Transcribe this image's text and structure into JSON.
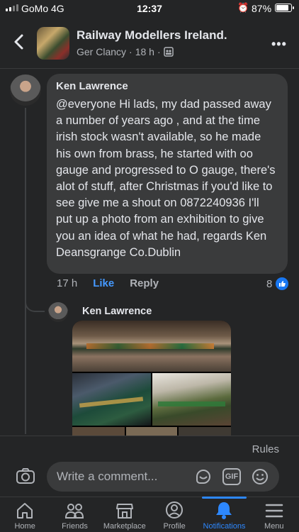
{
  "status_bar": {
    "carrier": "GoMo  4G",
    "time": "12:37",
    "battery_percent": "87%",
    "battery_level": 0.87,
    "alarm_icon": "alarm-clock-icon"
  },
  "header": {
    "group_name": "Railway Modellers Ireland.",
    "poster_name": "Ger Clancy",
    "post_age": "18 h",
    "separator": "·",
    "privacy_icon": "group-members-icon",
    "more_label": "•••"
  },
  "comment": {
    "author": "Ken Lawrence",
    "text": "@everyone Hi lads, my dad passed away a number of years ago , and at the time irish stock wasn't available,  so he made his own from brass, he started with oo gauge and progressed to O gauge, there's alot of stuff, after Christmas if you'd like to see give me a shout on 0872240936 I'll put up a photo from an exhibition to give you an idea of what he had, regards Ken\nDeansgrange Co.Dublin",
    "time": "17 h",
    "like_label": "Like",
    "reply_label": "Reply",
    "reaction_count": "8"
  },
  "reply": {
    "author": "Ken Lawrence",
    "photo_count_visible": 6
  },
  "composer": {
    "rules_label": "Rules",
    "placeholder": "Write a comment...",
    "gif_label": "GIF"
  },
  "tabs": [
    {
      "label": "Home",
      "icon": "home-icon"
    },
    {
      "label": "Friends",
      "icon": "friends-icon"
    },
    {
      "label": "Marketplace",
      "icon": "marketplace-icon"
    },
    {
      "label": "Profile",
      "icon": "profile-icon"
    },
    {
      "label": "Notifications",
      "icon": "bell-icon",
      "active": true
    },
    {
      "label": "Menu",
      "icon": "menu-icon"
    }
  ],
  "colors": {
    "background": "#242526",
    "bubble": "#3a3b3c",
    "accent": "#2d88ff",
    "text_primary": "#e4e6eb",
    "text_secondary": "#b0b3b8"
  }
}
